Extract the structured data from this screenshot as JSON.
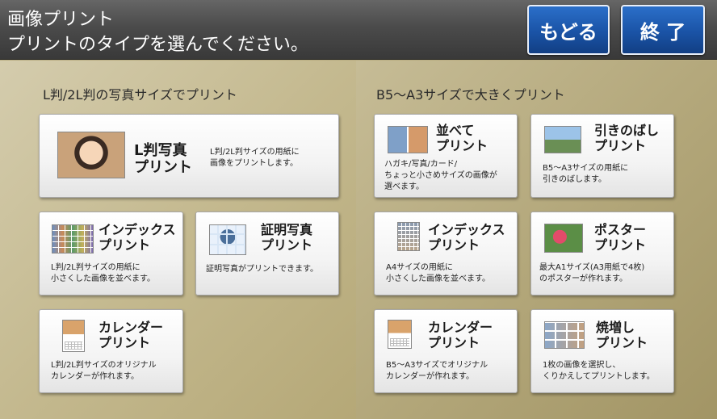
{
  "header": {
    "title_line1": "画像プリント",
    "title_line2": "プリントのタイプを選んでください。",
    "back_label": "もどる",
    "end_label": "終 了"
  },
  "left_section": {
    "title": "L判/2L判の写真サイズでプリント",
    "cards": [
      {
        "title1": "L判写真",
        "title2": "プリント",
        "desc1": "L判/2L判サイズの用紙に",
        "desc2": "画像をプリントします。",
        "icon": "photo-icon"
      },
      {
        "title1": "インデックス",
        "title2": "プリント",
        "desc1": "L判/2L判サイズの用紙に",
        "desc2": "小さくした画像を並べます。",
        "icon": "index-icon"
      },
      {
        "title1": "証明写真",
        "title2": "プリント",
        "desc1": "証明写真がプリントできます。",
        "icon": "id-photo-icon"
      },
      {
        "title1": "カレンダー",
        "title2": "プリント",
        "desc1": "L判/2L判サイズのオリジナル",
        "desc2": "カレンダーが作れます。",
        "icon": "calendar-icon"
      }
    ]
  },
  "right_section": {
    "title": "B5～A3サイズで大きくプリント",
    "cards": [
      {
        "title1": "並べて",
        "title2": "プリント",
        "desc1": "ハガキ/写真/カード/",
        "desc2": "ちょっと小さめサイズの画像が",
        "desc3": "選べます。",
        "icon": "arrange-icon"
      },
      {
        "title1": "引きのばし",
        "title2": "プリント",
        "desc1": "B5～A3サイズの用紙に",
        "desc2": "引きのばします。",
        "icon": "enlarge-icon"
      },
      {
        "title1": "インデックス",
        "title2": "プリント",
        "desc1": "A4サイズの用紙に",
        "desc2": "小さくした画像を並べます。",
        "icon": "index-icon"
      },
      {
        "title1": "ポスター",
        "title2": "プリント",
        "desc1": "最大A1サイズ(A3用紙で4枚)",
        "desc2": "のポスターが作れます。",
        "icon": "poster-icon"
      },
      {
        "title1": "カレンダー",
        "title2": "プリント",
        "desc1": "B5～A3サイズでオリジナル",
        "desc2": "カレンダーが作れます。",
        "icon": "calendar-icon"
      },
      {
        "title1": "焼増し",
        "title2": "プリント",
        "desc1": "1枚の画像を選択し、",
        "desc2": "くりかえしてプリントします。",
        "icon": "reprint-icon"
      }
    ]
  }
}
